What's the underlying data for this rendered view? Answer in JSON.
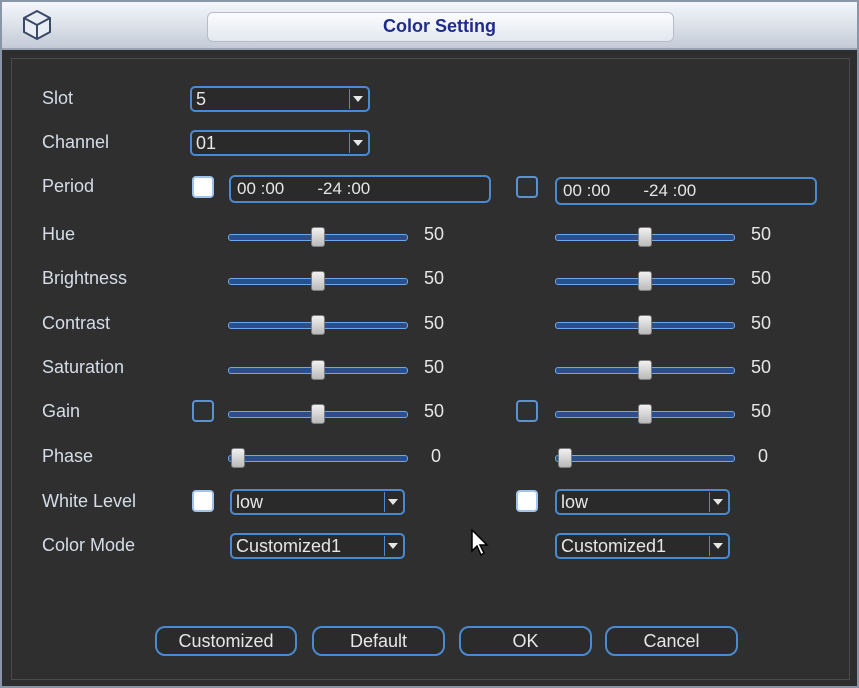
{
  "window": {
    "title": "Color Setting"
  },
  "slot": {
    "label": "Slot",
    "value": "5"
  },
  "channel": {
    "label": "Channel",
    "value": "01"
  },
  "period": {
    "label": "Period",
    "p1": "00 :00       -24 :00",
    "p2": "00 :00       -24 :00"
  },
  "hue": {
    "label": "Hue",
    "v1": 50,
    "v2": 50
  },
  "brightness": {
    "label": "Brightness",
    "v1": 50,
    "v2": 50
  },
  "contrast": {
    "label": "Contrast",
    "v1": 50,
    "v2": 50
  },
  "saturation": {
    "label": "Saturation",
    "v1": 50,
    "v2": 50
  },
  "gain": {
    "label": "Gain",
    "v1": 50,
    "v2": 50
  },
  "phase": {
    "label": "Phase",
    "v1": 0,
    "v2": 0
  },
  "white_level": {
    "label": "White Level",
    "v1": "low",
    "v2": "low"
  },
  "color_mode": {
    "label": "Color Mode",
    "v1": "Customized1",
    "v2": "Customized1"
  },
  "buttons": {
    "customized": "Customized",
    "default": "Default",
    "ok": "OK",
    "cancel": "Cancel"
  },
  "icons": {
    "title": "cube-logo-icon",
    "cursor": "mouse-pointer-icon"
  },
  "colors": {
    "accent": "#4a8ad0",
    "title_text": "#1f2c8c",
    "background": "#2f2f2f"
  }
}
